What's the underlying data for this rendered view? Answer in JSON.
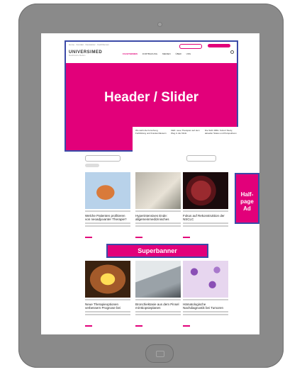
{
  "overlays": {
    "header_slider": "Header / Slider",
    "halfpage_line1": "Half-",
    "halfpage_line2": "page Ad",
    "superbanner": "Superbanner"
  },
  "site": {
    "logo": "UNIVERSIMED",
    "nav": [
      "FACHTHEMEN",
      "FORTBILDUNG",
      "MEDIEN",
      "ÜBER UNS"
    ]
  },
  "teasers": [
    "Wo steht die Forschung Fortbildung und Krankenhäusern",
    "CED: neue Therapien auf dem Weg in die Klinik",
    "Die Sicht DBG: Kohort Study, aktueller Status und Perspektiven"
  ],
  "articles": [
    {
      "title": "Welche Patienten profitieren von neoadjuvanter Therapie?",
      "icon": "pancreas-illustration"
    },
    {
      "title": "Hyperintensives Ende: allgemeinmedizinisches Frontalcolonblock",
      "icon": "consultation-photo"
    },
    {
      "title": "Fokus auf Rekonstruktion der NSCLC",
      "icon": "lungs-illustration"
    },
    {
      "title": "Neue Therapieoptionen verbessern Prognose bei Hirnmetastasen",
      "icon": "joint-xray-illustration"
    },
    {
      "title": "Bronchiektasie aus dem Pinsel mit Biopsieplanen",
      "icon": "doctor-photo"
    },
    {
      "title": "Hämatologische Nachdiagnostik bei Tumoren des Blutes",
      "icon": "blood-cells-illustration"
    }
  ],
  "colors": {
    "accent": "#e2007a",
    "frame": "#3b4aa8"
  }
}
